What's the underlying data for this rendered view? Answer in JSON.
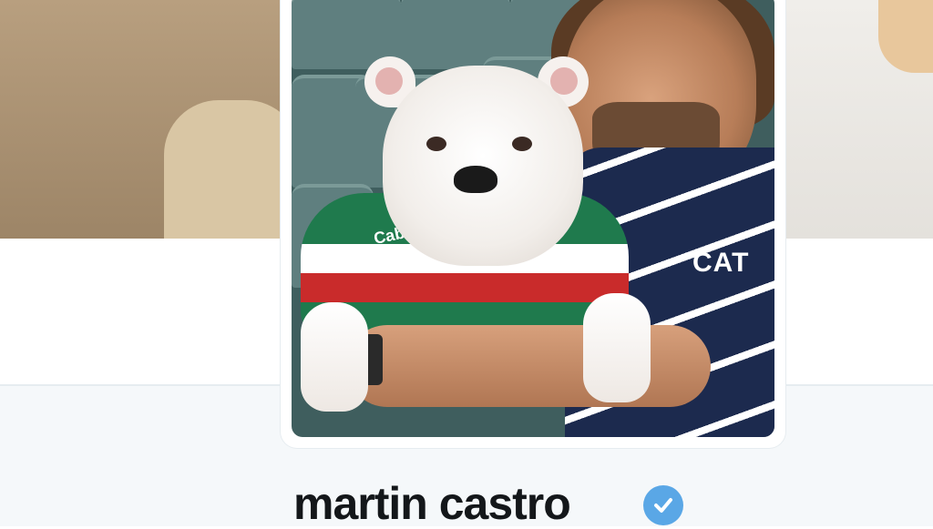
{
  "profile": {
    "display_name": "martin castro",
    "verified": true
  },
  "avatar": {
    "jersey_dog_text": "Cabot",
    "jersey_man_text": "CAT"
  },
  "colors": {
    "verified_badge": "#5aa7e6",
    "name_text": "#14171a",
    "profile_background": "#f5f8fa"
  },
  "icons": {
    "verified": "verified-check-icon"
  }
}
